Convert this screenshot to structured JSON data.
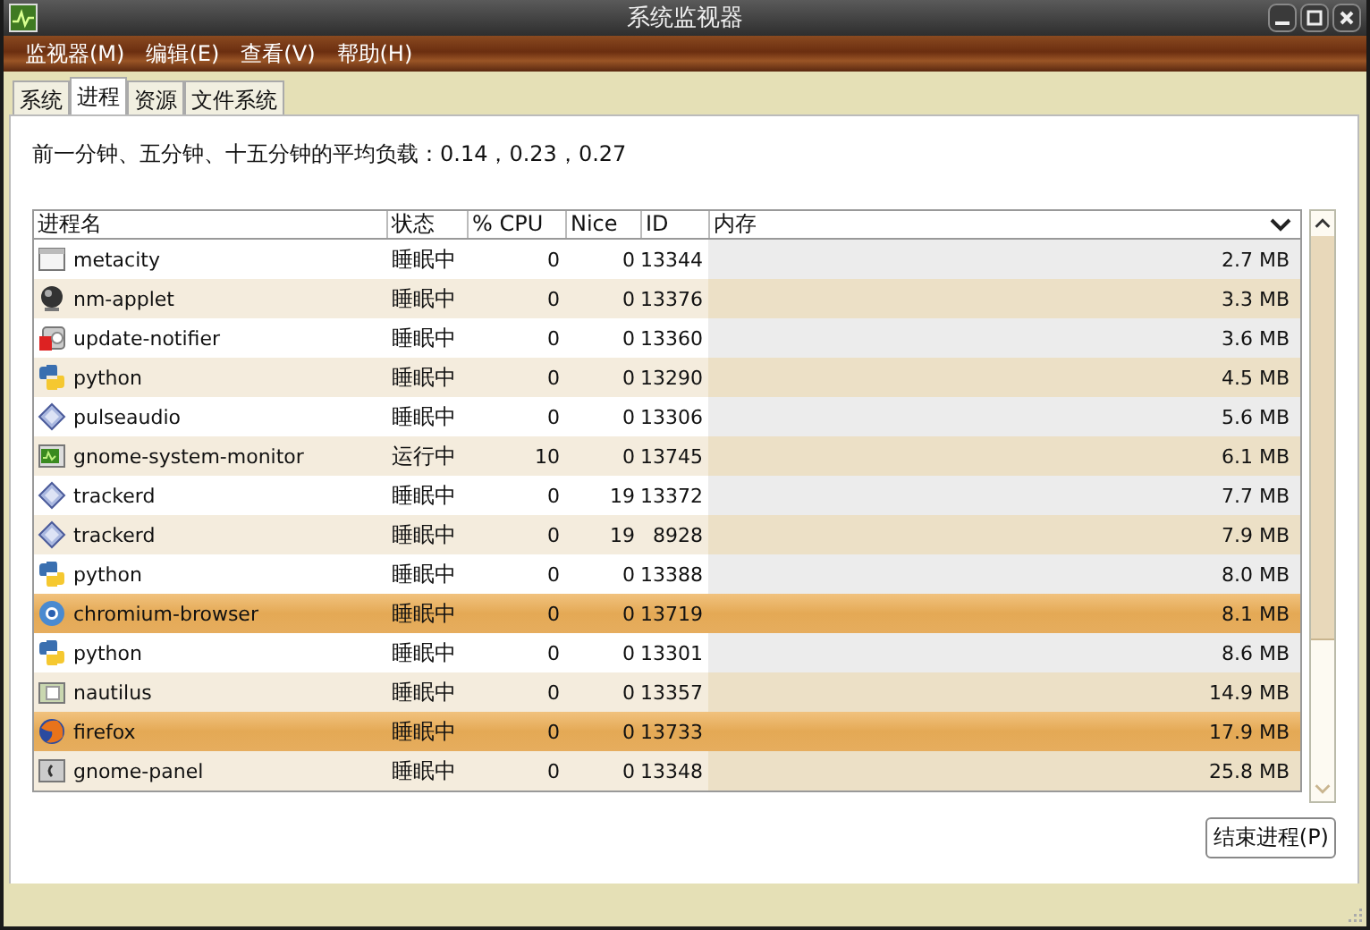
{
  "window": {
    "title": "系统监视器"
  },
  "menu": [
    "监视器(M)",
    "编辑(E)",
    "查看(V)",
    "帮助(H)"
  ],
  "tabs": [
    {
      "label": "系统",
      "selected": false
    },
    {
      "label": "进程",
      "selected": true
    },
    {
      "label": "资源",
      "selected": false
    },
    {
      "label": "文件系统",
      "selected": false
    }
  ],
  "load_average": "前一分钟、五分钟、十五分钟的平均负载：0.14，0.23，0.27",
  "table": {
    "columns": [
      "进程名",
      "状态",
      "% CPU",
      "Nice",
      "ID",
      "内存"
    ],
    "rows": [
      {
        "name": "metacity",
        "status": "睡眠中",
        "cpu": "0",
        "nice": "0",
        "id": "13344",
        "memory": "2.7 MB",
        "selected": false
      },
      {
        "name": "nm-applet",
        "status": "睡眠中",
        "cpu": "0",
        "nice": "0",
        "id": "13376",
        "memory": "3.3 MB",
        "selected": false
      },
      {
        "name": "update-notifier",
        "status": "睡眠中",
        "cpu": "0",
        "nice": "0",
        "id": "13360",
        "memory": "3.6 MB",
        "selected": false
      },
      {
        "name": "python",
        "status": "睡眠中",
        "cpu": "0",
        "nice": "0",
        "id": "13290",
        "memory": "4.5 MB",
        "selected": false
      },
      {
        "name": "pulseaudio",
        "status": "睡眠中",
        "cpu": "0",
        "nice": "0",
        "id": "13306",
        "memory": "5.6 MB",
        "selected": false
      },
      {
        "name": "gnome-system-monitor",
        "status": "运行中",
        "cpu": "10",
        "nice": "0",
        "id": "13745",
        "memory": "6.1 MB",
        "selected": false
      },
      {
        "name": "trackerd",
        "status": "睡眠中",
        "cpu": "0",
        "nice": "19",
        "id": "13372",
        "memory": "7.7 MB",
        "selected": false
      },
      {
        "name": "trackerd",
        "status": "睡眠中",
        "cpu": "0",
        "nice": "19",
        "id": "8928",
        "memory": "7.9 MB",
        "selected": false
      },
      {
        "name": "python",
        "status": "睡眠中",
        "cpu": "0",
        "nice": "0",
        "id": "13388",
        "memory": "8.0 MB",
        "selected": false
      },
      {
        "name": "chromium-browser",
        "status": "睡眠中",
        "cpu": "0",
        "nice": "0",
        "id": "13719",
        "memory": "8.1 MB",
        "selected": true
      },
      {
        "name": "python",
        "status": "睡眠中",
        "cpu": "0",
        "nice": "0",
        "id": "13301",
        "memory": "8.6 MB",
        "selected": false
      },
      {
        "name": "nautilus",
        "status": "睡眠中",
        "cpu": "0",
        "nice": "0",
        "id": "13357",
        "memory": "14.9 MB",
        "selected": false
      },
      {
        "name": "firefox",
        "status": "睡眠中",
        "cpu": "0",
        "nice": "0",
        "id": "13733",
        "memory": "17.9 MB",
        "selected": true
      },
      {
        "name": "gnome-panel",
        "status": "睡眠中",
        "cpu": "0",
        "nice": "0",
        "id": "13348",
        "memory": "25.8 MB",
        "selected": false
      }
    ]
  },
  "buttons": [
    "结束进程(P)"
  ]
}
